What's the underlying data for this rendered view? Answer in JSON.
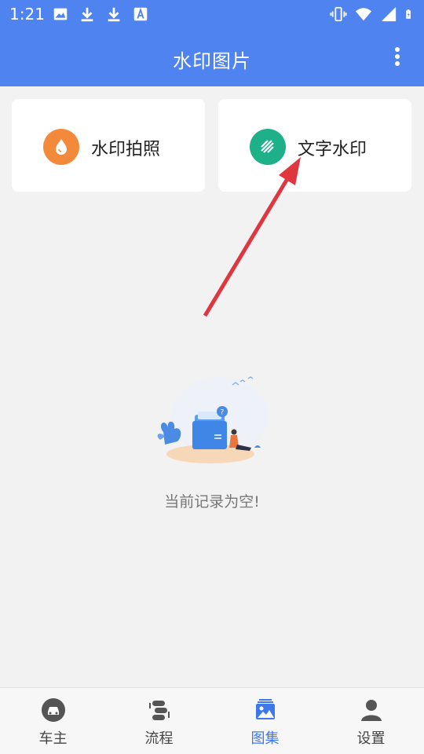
{
  "status_bar": {
    "time": "1:21",
    "left_icons": [
      "image-icon",
      "download-icon",
      "download-icon",
      "text-a-icon"
    ],
    "right_icons": [
      "vibrate-icon",
      "wifi-icon",
      "signal-icon",
      "battery-icon"
    ]
  },
  "app_bar": {
    "title": "水印图片",
    "menu_icon": "more-vert-icon"
  },
  "cards": [
    {
      "label": "水印拍照",
      "icon": "droplet-icon",
      "color": "#f38a3b"
    },
    {
      "label": "文字水印",
      "icon": "hatch-icon",
      "color": "#1eb089"
    }
  ],
  "annotation": {
    "arrow_color": "#e0363f"
  },
  "empty_state": {
    "message": "当前记录为空!",
    "illustration": "empty-folder-illustration"
  },
  "bottom_nav": {
    "active": "图集",
    "items": [
      {
        "label": "车主",
        "icon": "car-icon"
      },
      {
        "label": "流程",
        "icon": "flow-icon"
      },
      {
        "label": "图集",
        "icon": "gallery-icon"
      },
      {
        "label": "设置",
        "icon": "user-icon"
      }
    ]
  },
  "colors": {
    "primary": "#4f83ef",
    "active_nav": "#3f78ea",
    "background": "#f2f2f2"
  }
}
